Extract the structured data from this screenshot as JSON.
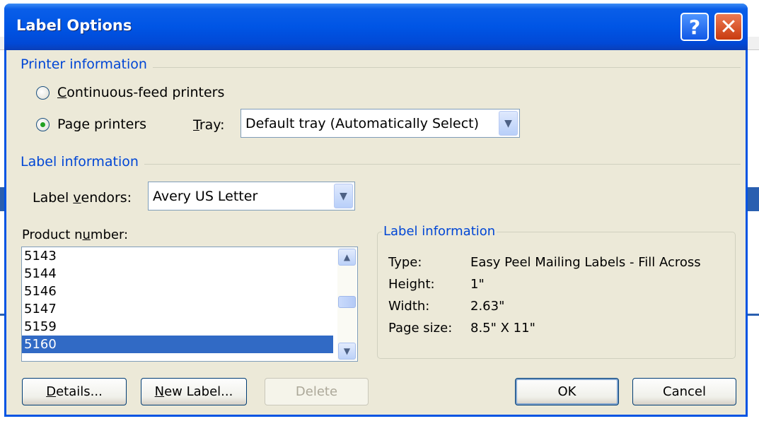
{
  "dialog": {
    "title": "Label Options"
  },
  "printer_info": {
    "group_title": "Printer information",
    "continuous_label_pre": "",
    "continuous_label_mnemonic": "C",
    "continuous_label_post": "ontinuous-feed printers",
    "page_label_pre": "Pa",
    "page_label_mnemonic": "g",
    "page_label_post": "e printers",
    "selected": "page",
    "tray_label_mnemonic": "T",
    "tray_label_post": "ray:",
    "tray_value": "Default tray (Automatically Select)"
  },
  "label_info": {
    "group_title": "Label information",
    "vendors_label_pre": "Label ",
    "vendors_label_mnemonic": "v",
    "vendors_label_post": "endors:",
    "vendor_value": "Avery US Letter"
  },
  "product": {
    "label_pre": "Product n",
    "label_mnemonic": "u",
    "label_post": "mber:",
    "items": [
      "5143",
      "5144",
      "5146",
      "5147",
      "5159",
      "5160"
    ],
    "selected_index": 5
  },
  "details_panel": {
    "title": "Label information",
    "rows": [
      {
        "key": "Type:",
        "value": "Easy Peel Mailing Labels - Fill Across"
      },
      {
        "key": "Height:",
        "value": "1\""
      },
      {
        "key": "Width:",
        "value": "2.63\""
      },
      {
        "key": "Page size:",
        "value": "8.5\" X 11\""
      }
    ]
  },
  "buttons": {
    "details_mnemonic": "D",
    "details_post": "etails...",
    "new_label_mnemonic": "N",
    "new_label_post": "ew Label...",
    "delete": "Delete",
    "ok": "OK",
    "cancel": "Cancel"
  },
  "colors": {
    "title_bar": "#0055e5",
    "group_title": "#0046d5",
    "selection": "#316ac5",
    "dialog_bg": "#ece9d8"
  }
}
